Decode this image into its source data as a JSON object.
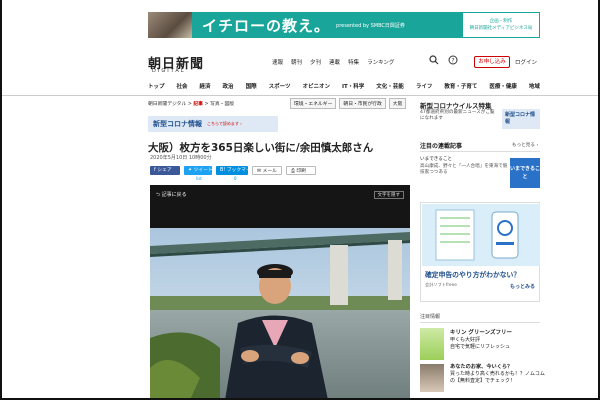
{
  "banner": {
    "title": "イチローの教え。",
    "sub": "presented by SMBC日興証券",
    "side_line1": "企画・制作",
    "side_line2": "朝日新聞社メディアビジネス局"
  },
  "header": {
    "logo": "朝日新聞",
    "logo_sub": "DIGITAL",
    "nav": [
      "速報",
      "朝刊",
      "夕刊",
      "連載",
      "特集",
      "ランキング"
    ],
    "apply": "お申し込み",
    "login": "ログイン"
  },
  "gnav": [
    "トップ",
    "社会",
    "経済",
    "政治",
    "国際",
    "スポーツ",
    "オピニオン",
    "IT・科学",
    "文化・芸能",
    "ライフ",
    "教育・子育て",
    "医療・健康",
    "地域"
  ],
  "breadcrumb": {
    "home": "朝日新聞デジタル",
    "sep1": ">",
    "section": "記事",
    "sep2": ">",
    "page": "写真・図版"
  },
  "tags": [
    "環境・エネルギー",
    "朝日・市民が行政",
    "大阪"
  ],
  "covid_banner": {
    "title": "新型コロナ情報",
    "link": "こちらで読めます ›"
  },
  "article": {
    "headline": "大阪）枚方を365日楽しい街に/余田慎太郎さん",
    "date": "2020年5月10日 10時00分"
  },
  "share": {
    "facebook": "シェア",
    "twitter": "ツイート",
    "twitter_count": "list",
    "hatena": "ブックマーク",
    "hatena_count": "0",
    "mail": "メール",
    "print": "印刷"
  },
  "photo_viewer": {
    "back": "記事に戻る",
    "caption_button": "文字を隠す"
  },
  "sidebar": {
    "covid_head": "新型コロナウイルス特集",
    "covid_text": "47都道府県別の最新ニュースがご覧になれます",
    "covid_thumb": "新型コロナ情報",
    "series_head": "注目の連載記事",
    "more": "もっと見る",
    "article_title": "いまできること",
    "article_sub": "高山康成、野々と「一人合唱」を東海で競技家つつある",
    "article_badge": "いまできること",
    "ad_title": "確定申告のやり方がわかない？",
    "ad_sponsor": "会計ソフトfreee",
    "ad_more": "もっとみる",
    "pickup": "注目情報",
    "ad2_title": "キリン グリーンズフリー",
    "ad2_line1": "甲くも大好評",
    "ad2_line2": "自宅で気軽にリフレッシュ",
    "ad3_title": "あなたのお家、今いくら？",
    "ad3_text": "買った時より高く売れるかも！？ノムコムの【無料査定】でチェック！"
  }
}
